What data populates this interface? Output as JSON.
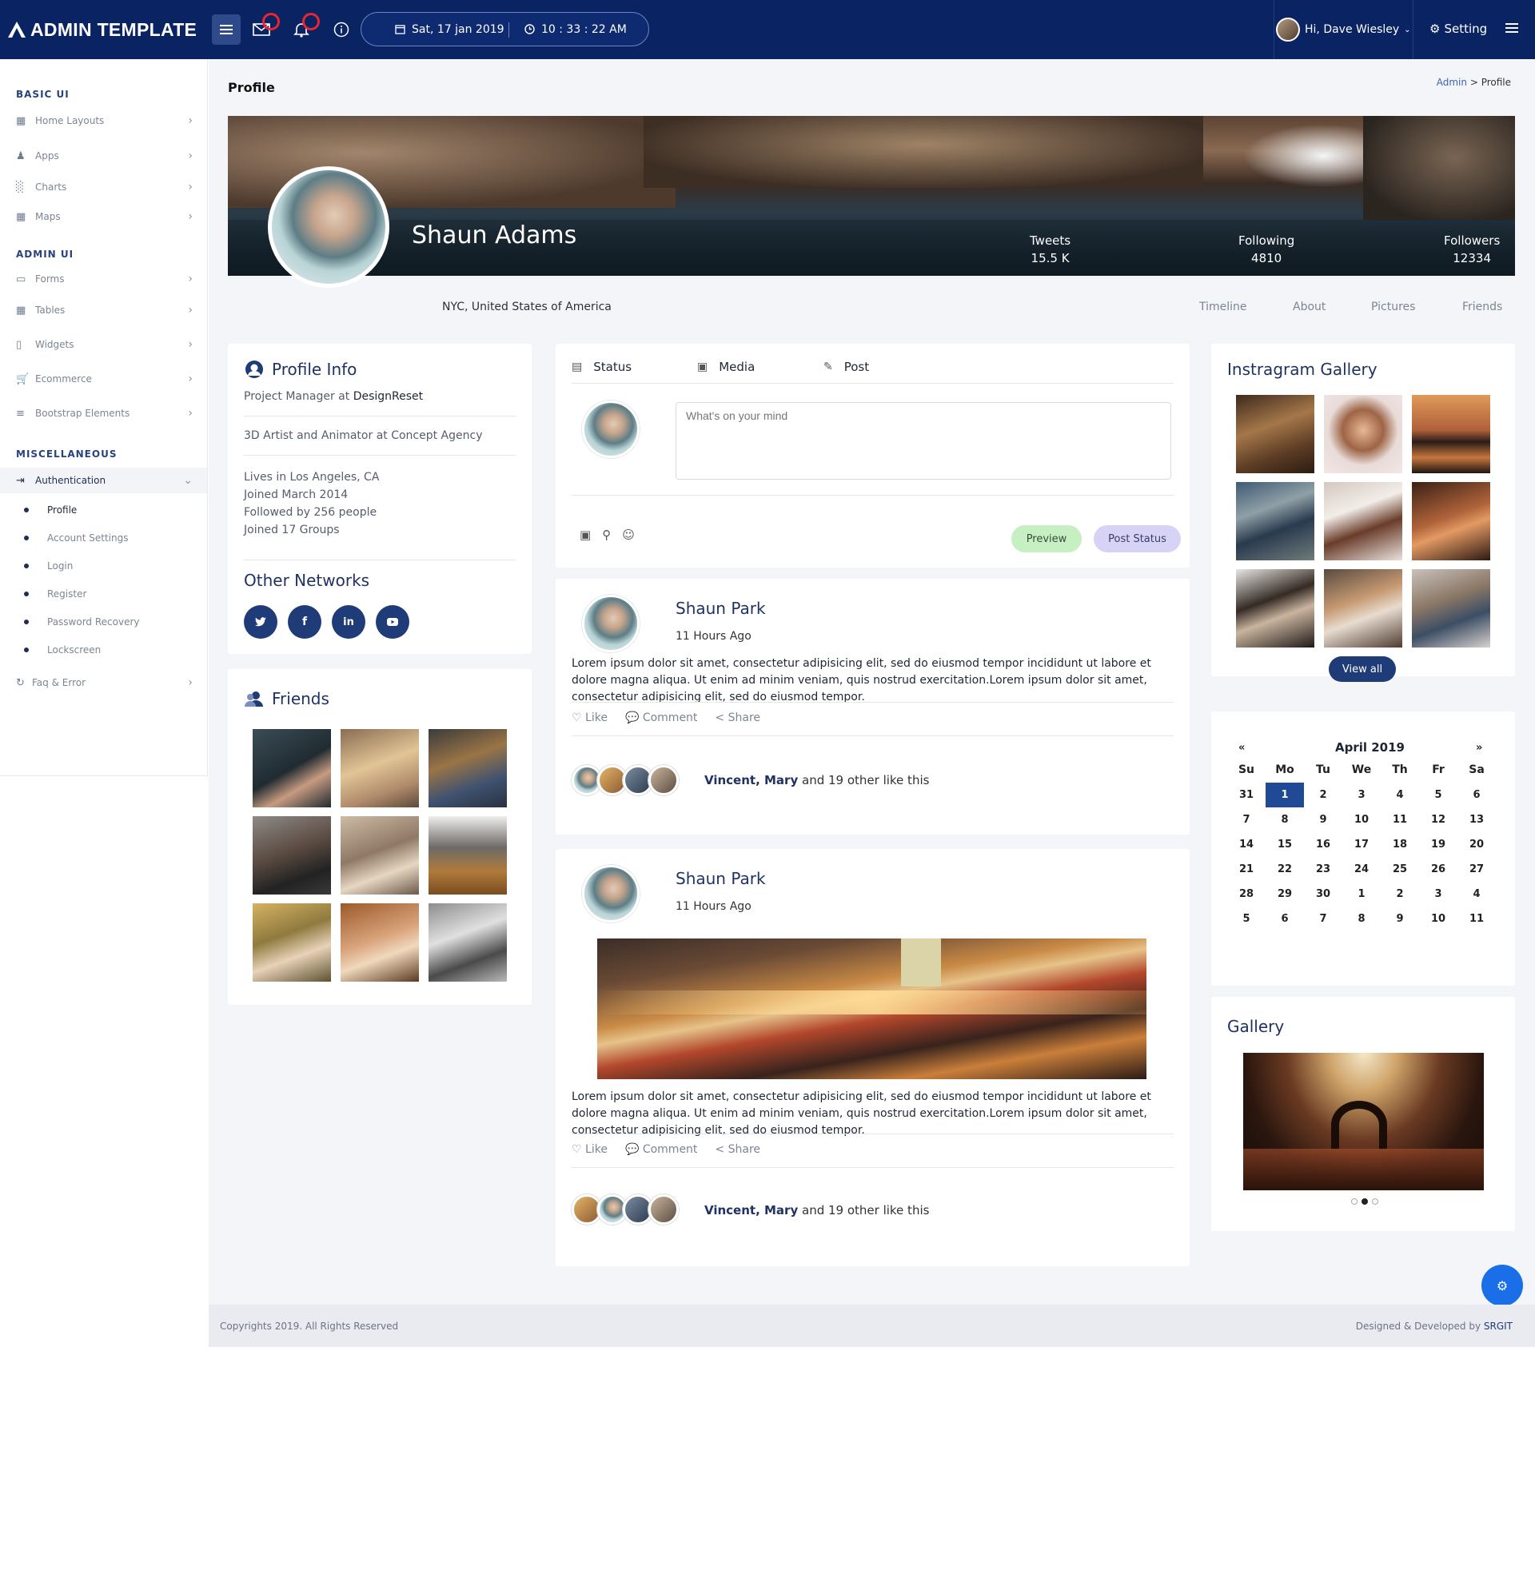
{
  "brand": "ADMIN TEMPLATE",
  "topbar": {
    "date": "Sat, 17 jan 2019",
    "time": "10 : 33 : 22 AM",
    "greeting": "Hi, Dave Wiesley",
    "setting_label": "Setting"
  },
  "sidebar": {
    "sections": [
      "BASIC UI",
      "ADMIN UI",
      "MISCELLANEOUS"
    ],
    "basic": [
      {
        "label": "Home Layouts",
        "icon": "grid-icon"
      },
      {
        "label": "Apps",
        "icon": "users-icon"
      },
      {
        "label": "Charts",
        "icon": "chart-icon"
      },
      {
        "label": "Maps",
        "icon": "map-icon"
      }
    ],
    "admin": [
      {
        "label": "Forms",
        "icon": "form-icon"
      },
      {
        "label": "Tables",
        "icon": "table-icon"
      },
      {
        "label": "Widgets",
        "icon": "widget-icon"
      },
      {
        "label": "Ecommerce",
        "icon": "cart-icon"
      },
      {
        "label": "Bootstrap Elements",
        "icon": "elements-icon"
      }
    ],
    "auth_label": "Authentication",
    "auth_items": [
      "Profile",
      "Account Settings",
      "Login",
      "Register",
      "Password Recovery",
      "Lockscreen"
    ],
    "faq_label": "Faq & Error"
  },
  "page": {
    "title": "Profile",
    "breadcrumb_root": "Admin",
    "breadcrumb_current": "Profile"
  },
  "profile": {
    "name": "Shaun Adams",
    "location": "NYC, United States of America",
    "stats": [
      {
        "label": "Tweets",
        "value": "15.5 K"
      },
      {
        "label": "Following",
        "value": "4810"
      },
      {
        "label": "Followers",
        "value": "12334"
      }
    ],
    "tabs": [
      "Timeline",
      "About",
      "Pictures",
      "Friends"
    ]
  },
  "profile_info": {
    "title": "Profile Info",
    "job1_prefix": "Project Manager at ",
    "job1_company": "DesignReset",
    "job2": "3D Artist and Animator at Concept Agency",
    "facts": [
      "Lives in Los Angeles, CA",
      "Joined March 2014",
      "Followed by 256 people",
      "Joined 17 Groups"
    ],
    "networks_title": "Other Networks",
    "networks": [
      "twitter-icon",
      "facebook-icon",
      "linkedin-icon",
      "youtube-icon"
    ]
  },
  "friends": {
    "title": "Friends"
  },
  "composer": {
    "tabs": [
      "Status",
      "Media",
      "Post"
    ],
    "placeholder": "What's on your mind",
    "preview_label": "Preview",
    "post_label": "Post Status"
  },
  "posts": [
    {
      "author": "Shaun Park",
      "time": "11 Hours Ago",
      "text": "Lorem ipsum dolor sit amet, consectetur adipisicing elit, sed do eiusmod tempor incididunt ut labore et dolore magna aliqua. Ut enim ad minim veniam, quis nostrud exercitation.Lorem ipsum dolor sit amet, consectetur adipisicing elit, sed do eiusmod tempor.",
      "actions": [
        "Like",
        "Comment",
        "Share"
      ],
      "likers": "Vincent, Mary",
      "likes_tail": " and 19 other like this"
    },
    {
      "author": "Shaun Park",
      "time": "11 Hours Ago",
      "text": "Lorem ipsum dolor sit amet, consectetur adipisicing elit, sed do eiusmod tempor incididunt ut labore et dolore magna aliqua. Ut enim ad minim veniam, quis nostrud exercitation.Lorem ipsum dolor sit amet, consectetur adipisicing elit, sed do eiusmod tempor.",
      "actions": [
        "Like",
        "Comment",
        "Share"
      ],
      "likers": "Vincent, Mary",
      "likes_tail": " and 19 other like this"
    }
  ],
  "instagram": {
    "title": "Instragram Gallery",
    "view_all": "View all"
  },
  "calendar": {
    "month": "April 2019",
    "prev": "«",
    "next": "»",
    "days": [
      "Su",
      "Mo",
      "Tu",
      "We",
      "Th",
      "Fr",
      "Sa"
    ],
    "weeks": [
      [
        "31",
        "1",
        "2",
        "3",
        "4",
        "5",
        "6"
      ],
      [
        "7",
        "8",
        "9",
        "10",
        "11",
        "12",
        "13"
      ],
      [
        "14",
        "15",
        "16",
        "17",
        "18",
        "19",
        "20"
      ],
      [
        "21",
        "22",
        "23",
        "24",
        "25",
        "26",
        "27"
      ],
      [
        "28",
        "29",
        "30",
        "1",
        "2",
        "3",
        "4"
      ],
      [
        "5",
        "6",
        "7",
        "8",
        "9",
        "10",
        "11"
      ]
    ],
    "selected": "1"
  },
  "gallery": {
    "title": "Gallery"
  },
  "footer": {
    "left": "Copyrights 2019. All Rights Reserved",
    "right_prefix": "Designed & Developed by ",
    "right_brand": "SRGIT"
  },
  "colors": {
    "navy": "#0a2362",
    "accent": "#1f3c78",
    "fab": "#1a6fe8",
    "preview_bg": "#c6f0c2",
    "post_bg": "#d7d3f7"
  }
}
